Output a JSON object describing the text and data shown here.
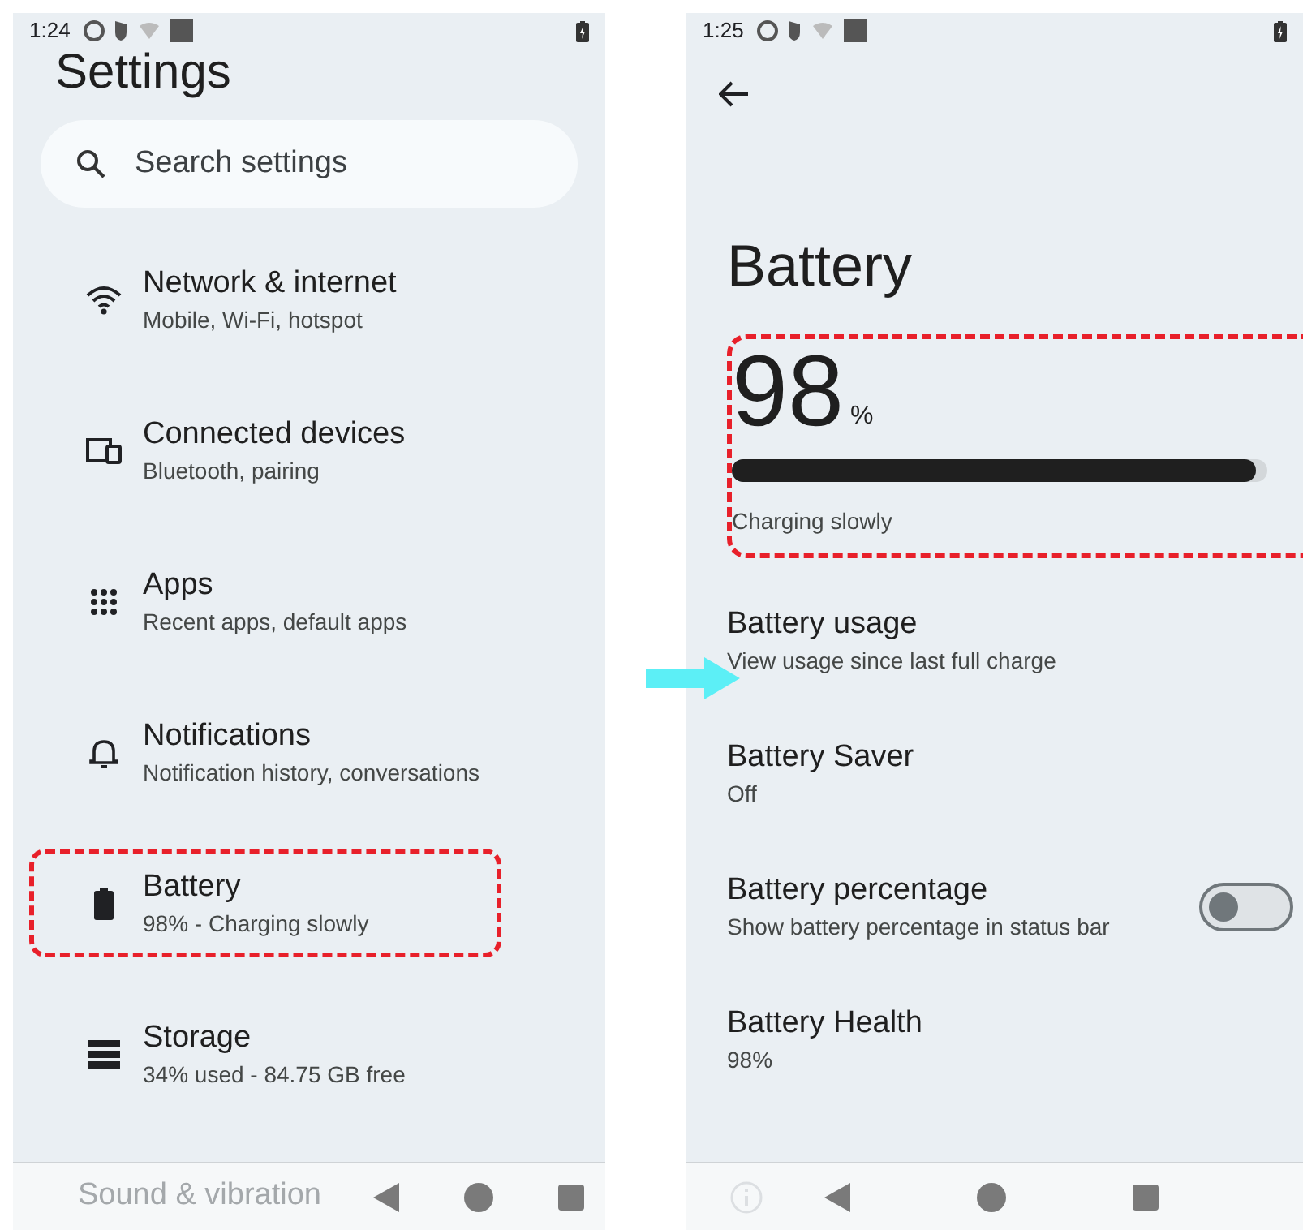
{
  "left_screen": {
    "status_bar": {
      "time": "1:24"
    },
    "title": "Settings",
    "search": {
      "placeholder": "Search settings"
    },
    "items": [
      {
        "kind": "wifi",
        "title": "Network & internet",
        "subtitle": "Mobile, Wi-Fi, hotspot",
        "highlighted": false
      },
      {
        "kind": "devices",
        "title": "Connected devices",
        "subtitle": "Bluetooth, pairing",
        "highlighted": false
      },
      {
        "kind": "apps",
        "title": "Apps",
        "subtitle": "Recent apps, default apps",
        "highlighted": false
      },
      {
        "kind": "bell",
        "title": "Notifications",
        "subtitle": "Notification history, conversations",
        "highlighted": false
      },
      {
        "kind": "battery",
        "title": "Battery",
        "subtitle": "98% - Charging slowly",
        "highlighted": true
      },
      {
        "kind": "storage",
        "title": "Storage",
        "subtitle": "34% used - 84.75 GB free",
        "highlighted": false
      }
    ],
    "partly_hidden_item": "Sound & vibration"
  },
  "right_screen": {
    "status_bar": {
      "time": "1:25"
    },
    "title": "Battery",
    "battery_level": {
      "percent": "98",
      "unit": "%",
      "level": 0.98,
      "status": "Charging slowly",
      "highlighted": true
    },
    "items": [
      {
        "kind": "link",
        "title": "Battery usage",
        "subtitle": "View usage since last full charge"
      },
      {
        "kind": "link",
        "title": "Battery Saver",
        "subtitle": "Off"
      },
      {
        "kind": "toggle",
        "title": "Battery percentage",
        "subtitle": "Show battery percentage in status bar",
        "on": false
      },
      {
        "kind": "link",
        "title": "Battery Health",
        "subtitle": "98%"
      }
    ]
  }
}
